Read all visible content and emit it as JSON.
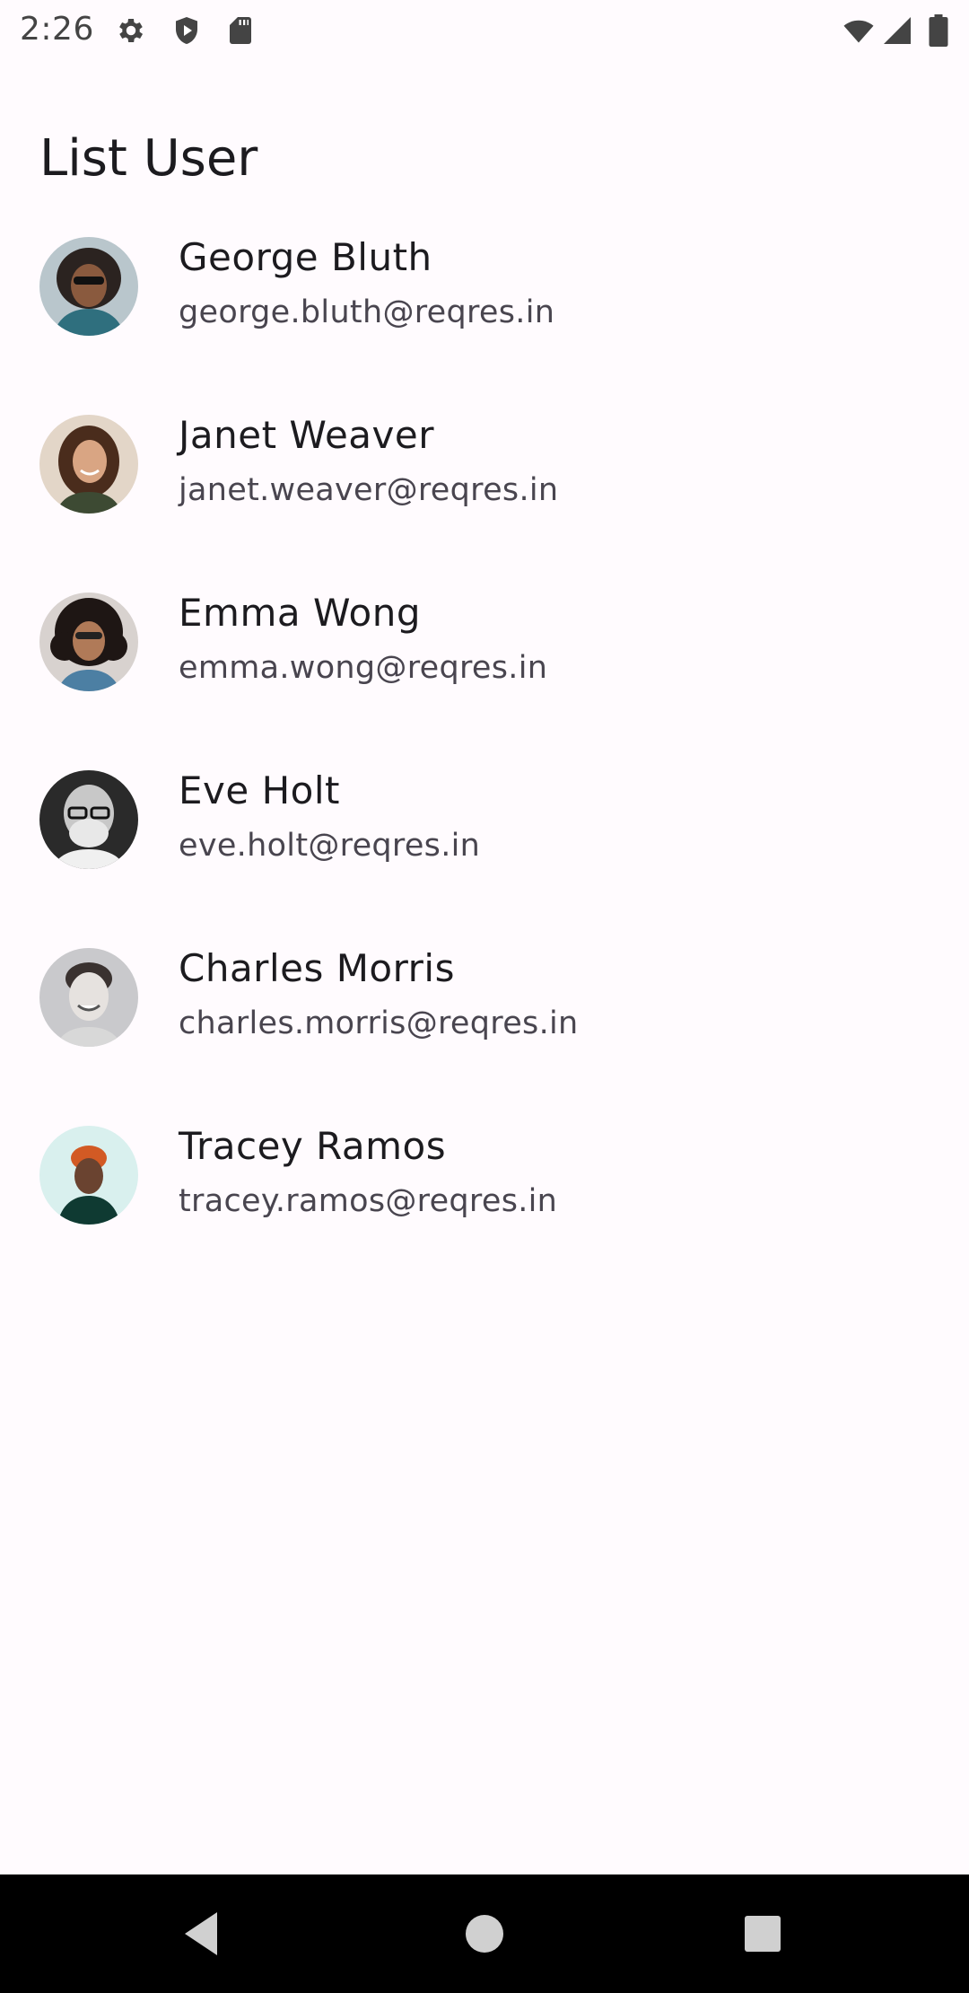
{
  "status_bar": {
    "time": "2:26",
    "icons": [
      "gear-icon",
      "shield-icon",
      "sd-card-icon",
      "wifi-icon",
      "signal-icon",
      "battery-icon"
    ]
  },
  "app_bar": {
    "title": "List User"
  },
  "users": [
    {
      "name": "George Bluth",
      "email": "george.bluth@reqres.in",
      "avatar_bg": "#b9c6cc"
    },
    {
      "name": "Janet Weaver",
      "email": "janet.weaver@reqres.in",
      "avatar_bg": "#e3d6c8"
    },
    {
      "name": "Emma Wong",
      "email": "emma.wong@reqres.in",
      "avatar_bg": "#d8d2cf"
    },
    {
      "name": "Eve Holt",
      "email": "eve.holt@reqres.in",
      "avatar_bg": "#2a2a2a"
    },
    {
      "name": "Charles Morris",
      "email": "charles.morris@reqres.in",
      "avatar_bg": "#c9c9cc"
    },
    {
      "name": "Tracey Ramos",
      "email": "tracey.ramos@reqres.in",
      "avatar_bg": "#d9f0ee"
    }
  ],
  "nav_bar": {
    "buttons": [
      "back-icon",
      "home-icon",
      "recents-icon"
    ]
  },
  "colors": {
    "background": "#fffbfe",
    "title_text": "#1c1b1f",
    "secondary_text": "#49454f",
    "nav_bar": "#000000"
  }
}
